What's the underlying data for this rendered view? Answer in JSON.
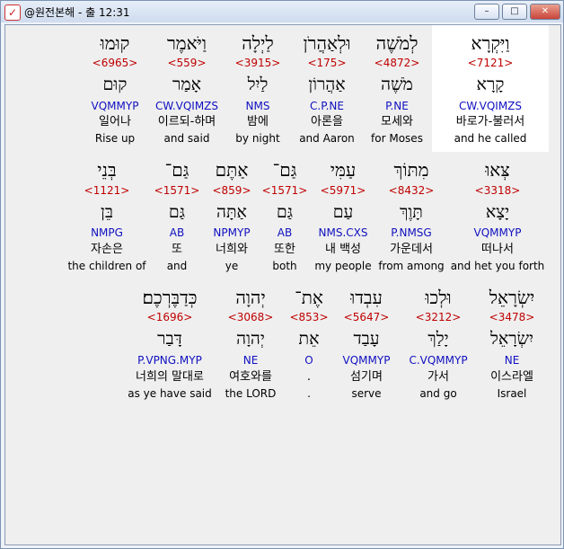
{
  "window": {
    "title": "@원전본해 - 출 12:31"
  },
  "controls": {
    "minimize": "–",
    "maximize": "□",
    "close": "✕"
  },
  "rows": [
    [
      {
        "heb": "וַיִּקְרָא",
        "strong": "<7121>",
        "lemma": "קָרָא",
        "parse": "CW.VQIMZS",
        "kor": "바로가-불러서",
        "eng": "and he called",
        "highlight": true
      },
      {
        "heb": "לְמֹשֶׁה",
        "strong": "<4872>",
        "lemma": "מֹשֶׁה",
        "parse": "P.NE",
        "kor": "모세와",
        "eng": "for Moses"
      },
      {
        "heb": "וּלְאַהֲרֹן",
        "strong": "<175>",
        "lemma": "אַהֲרוֹן",
        "parse": "C.P.NE",
        "kor": "아론을",
        "eng": "and Aaron"
      },
      {
        "heb": "לַיְלָה",
        "strong": "<3915>",
        "lemma": "לַיִל",
        "parse": "NMS",
        "kor": "밤에",
        "eng": "by night"
      },
      {
        "heb": "וַיֹּאמֶר",
        "strong": "<559>",
        "lemma": "אָמַר",
        "parse": "CW.VQIMZS",
        "kor": "이르되-하며",
        "eng": "and said"
      },
      {
        "heb": "קוּמוּ",
        "strong": "<6965>",
        "lemma": "קוּם",
        "parse": "VQMMYP",
        "kor": "일어나",
        "eng": "Rise up"
      }
    ],
    [
      {
        "heb": "צְּאוּ",
        "strong": "<3318>",
        "lemma": "יָצָא",
        "parse": "VQMMYP",
        "kor": "떠나서",
        "eng": "and het you forth"
      },
      {
        "heb": "מִתּוֹךְ",
        "strong": "<8432>",
        "lemma": "תָּוֶךְ",
        "parse": "P.NMSG",
        "kor": "가운데서",
        "eng": "from among"
      },
      {
        "heb": "עַמִּי",
        "strong": "<5971>",
        "lemma": "עַם",
        "parse": "NMS.CXS",
        "kor": "내 백성",
        "eng": "my people"
      },
      {
        "heb": "גַּם־",
        "strong": "<1571>",
        "lemma": "גַּם",
        "parse": "AB",
        "kor": "또한",
        "eng": "both"
      },
      {
        "heb": "אַתֶּם",
        "strong": "<859>",
        "lemma": "אַתָּה",
        "parse": "NPMYP",
        "kor": "너희와",
        "eng": "ye"
      },
      {
        "heb": "גַּם־",
        "strong": "<1571>",
        "lemma": "גַּם",
        "parse": "AB",
        "kor": "또",
        "eng": "and"
      },
      {
        "heb": "בְּנֵי",
        "strong": "<1121>",
        "lemma": "בֵּן",
        "parse": "NMPG",
        "kor": "자손은",
        "eng": "the children of"
      }
    ],
    [
      {
        "heb": "יִשְׂרָאֵל",
        "strong": "<3478>",
        "lemma": "יִשְׂרָאֵל",
        "parse": "NE",
        "kor": "이스라엘",
        "eng": "Israel"
      },
      {
        "heb": "וּלְכוּ",
        "strong": "<3212>",
        "lemma": "יָלַךְ",
        "parse": "C.VQMMYP",
        "kor": "가서",
        "eng": "and go"
      },
      {
        "heb": "עִבְדוּ",
        "strong": "<5647>",
        "lemma": "עָבַד",
        "parse": "VQMMYP",
        "kor": "섬기며",
        "eng": "serve"
      },
      {
        "heb": "אֶת־",
        "strong": "<853>",
        "lemma": "אֵת",
        "parse": "O",
        "kor": ".",
        "eng": "."
      },
      {
        "heb": "יְהוָה",
        "strong": "<3068>",
        "lemma": "יְהוָה",
        "parse": "NE",
        "kor": "여호와를",
        "eng": "the LORD"
      },
      {
        "heb": "כְּדַבֶּרְכֶם׃",
        "strong": "<1696>",
        "lemma": "דָּבַר",
        "parse": "P.VPNG.MYP",
        "kor": "너희의 말대로",
        "eng": "as ye have said"
      }
    ]
  ]
}
